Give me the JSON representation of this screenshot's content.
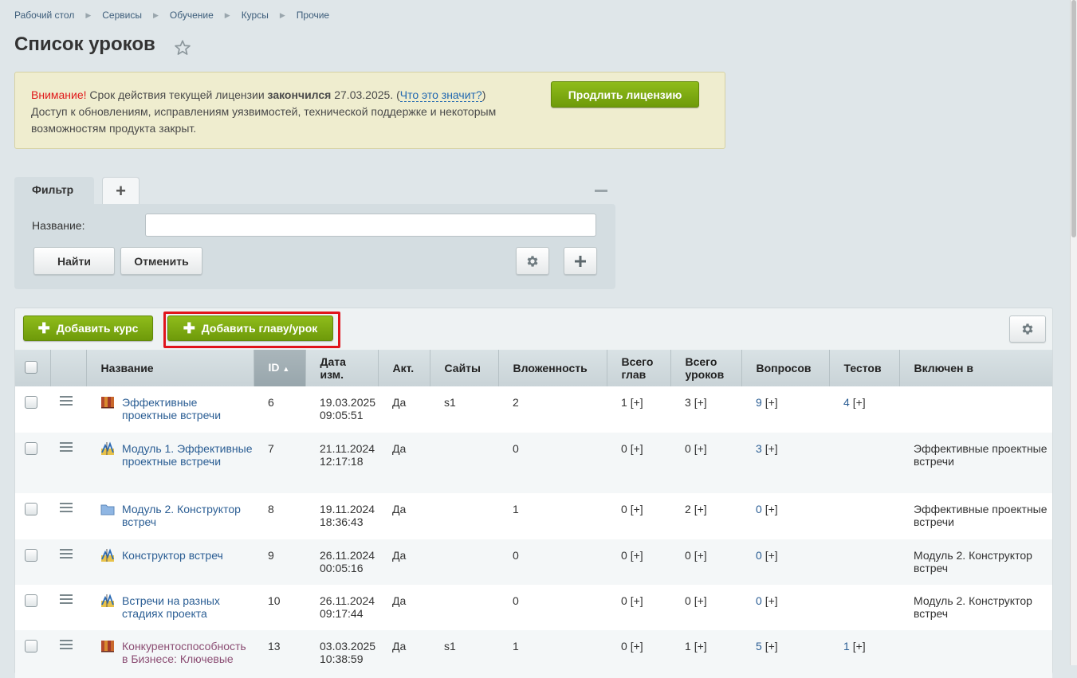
{
  "breadcrumb": [
    "Рабочий стол",
    "Сервисы",
    "Обучение",
    "Курсы",
    "Прочие"
  ],
  "page_title": "Список уроков",
  "notice": {
    "warn": "Внимание!",
    "text1": " Срок действия текущей лицензии ",
    "bold": "закончился",
    "text2": " 27.03.2025. (",
    "link": "Что это значит?",
    "text3": ")",
    "text4": "Доступ к обновлениям, исправлениям уязвимостей, технической поддержке и некоторым возможностям продукта закрыт.",
    "button": "Продлить лицензию"
  },
  "filter": {
    "tab_label": "Фильтр",
    "add_tab": "+",
    "field_label": "Название:",
    "field_value": "",
    "find_label": "Найти",
    "cancel_label": "Отменить"
  },
  "toolbar": {
    "add_course": "Добавить курс",
    "add_lesson": "Добавить главу/урок"
  },
  "columns": {
    "name": "Название",
    "id": "ID",
    "date_1": "Дата",
    "date_2": "изм.",
    "active": "Акт.",
    "sites": "Сайты",
    "nesting": "Вложенность",
    "chapters_1": "Всего",
    "chapters_2": "глав",
    "lessons_1": "Всего",
    "lessons_2": "уроков",
    "questions": "Вопросов",
    "tests": "Тестов",
    "included": "Включен в"
  },
  "rows": [
    {
      "icon": "course-book-icon",
      "name": "Эффективные проектные встречи",
      "id": "6",
      "date": "19.03.2025",
      "time": "09:05:51",
      "active": "Да",
      "site": "s1",
      "nesting": "2",
      "chapters": "1",
      "lessons": "3",
      "questions": "9",
      "tests": "4",
      "included": "",
      "visited": false
    },
    {
      "icon": "lesson-icon",
      "name": "Модуль 1. Эффективные проектные встречи",
      "id": "7",
      "date": "21.11.2024",
      "time": "12:17:18",
      "active": "Да",
      "site": "",
      "nesting": "0",
      "chapters": "0",
      "lessons": "0",
      "questions": "3",
      "tests": "",
      "included": "Эффективные проектные встречи",
      "visited": false
    },
    {
      "icon": "folder-icon",
      "name": "Модуль 2. Конструктор встреч",
      "id": "8",
      "date": "19.11.2024",
      "time": "18:36:43",
      "active": "Да",
      "site": "",
      "nesting": "1",
      "chapters": "0",
      "lessons": "2",
      "questions": "0",
      "tests": "",
      "included": "Эффективные проектные встречи",
      "visited": false
    },
    {
      "icon": "lesson-icon",
      "name": "Конструктор встреч",
      "id": "9",
      "date": "26.11.2024",
      "time": "00:05:16",
      "active": "Да",
      "site": "",
      "nesting": "0",
      "chapters": "0",
      "lessons": "0",
      "questions": "0",
      "tests": "",
      "included": "Модуль 2. Конструктор встреч",
      "visited": false
    },
    {
      "icon": "lesson-icon",
      "name": "Встречи на разных стадиях проекта",
      "id": "10",
      "date": "26.11.2024",
      "time": "09:17:44",
      "active": "Да",
      "site": "",
      "nesting": "0",
      "chapters": "0",
      "lessons": "0",
      "questions": "0",
      "tests": "",
      "included": "Модуль 2. Конструктор встреч",
      "visited": false
    },
    {
      "icon": "course-book-icon",
      "name": "Конкурентоспособность в Бизнесе: Ключевые",
      "id": "13",
      "date": "03.03.2025",
      "time": "10:38:59",
      "active": "Да",
      "site": "s1",
      "nesting": "1",
      "chapters": "0",
      "lessons": "1",
      "questions": "5",
      "tests": "1",
      "included": "",
      "visited": true
    }
  ],
  "plus_marker": "[+]",
  "colors": {
    "accent_green": "#7aa70f",
    "link_blue": "#2b5e94",
    "highlight_red": "#e0141c"
  }
}
